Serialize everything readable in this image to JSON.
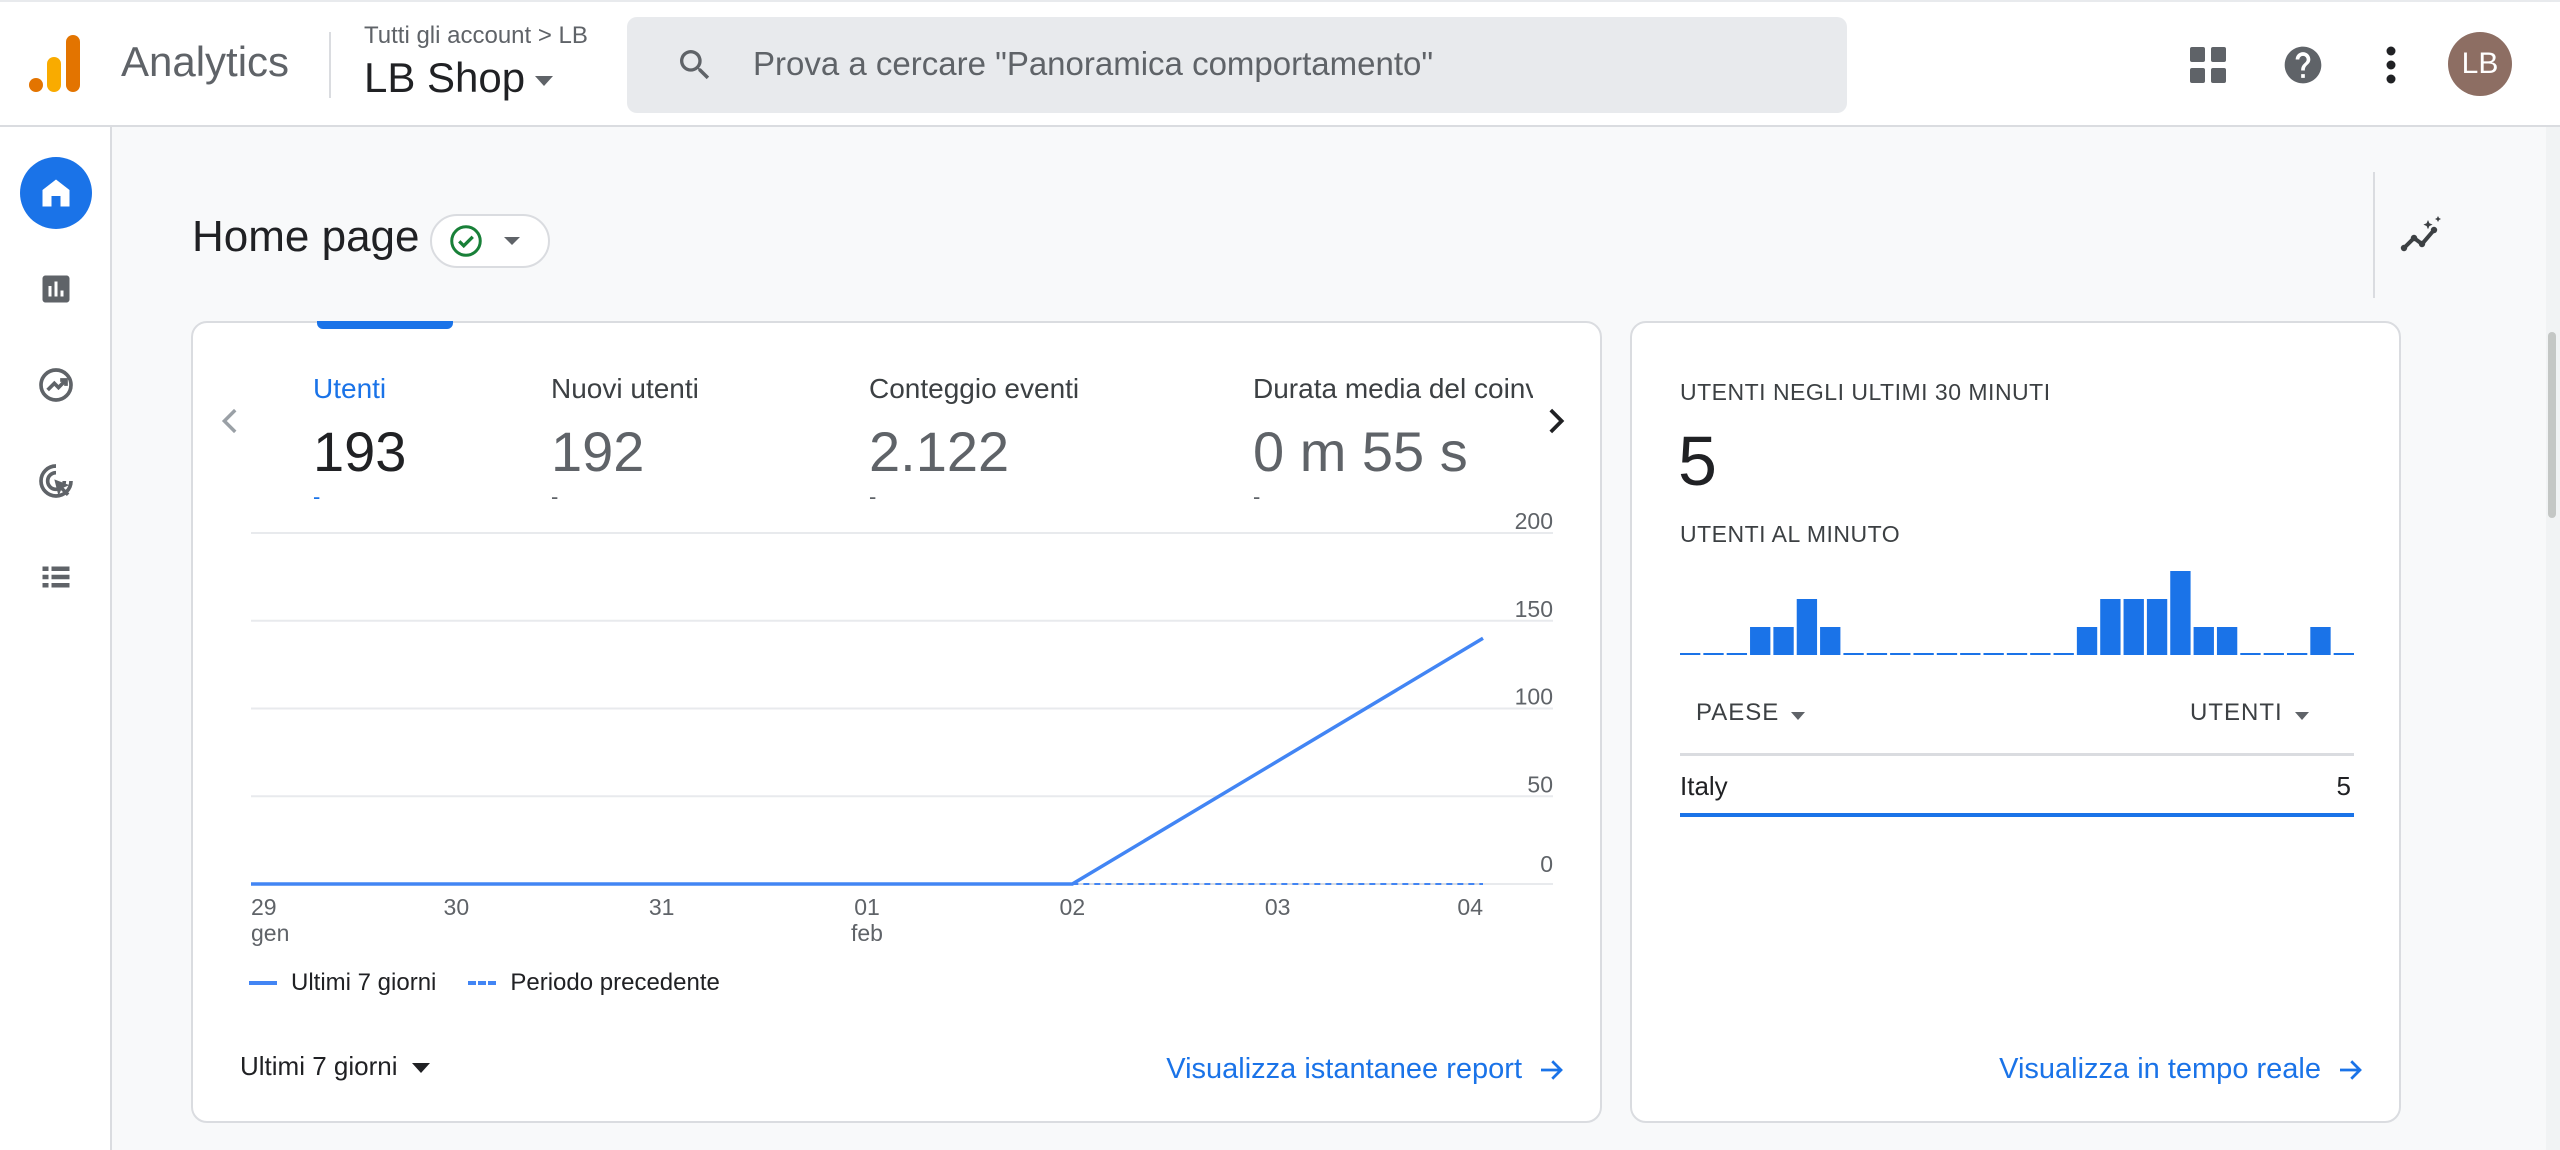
{
  "header": {
    "app_name": "Analytics",
    "breadcrumb": "Tutti gli account > LB",
    "property": "LB Shop",
    "search_placeholder": "Prova a cercare \"Panoramica comportamento\"",
    "avatar_initials": "LB",
    "icons": [
      "apps-grid-icon",
      "help-icon",
      "more-vert-icon"
    ]
  },
  "leftnav": {
    "items": [
      {
        "name": "home",
        "icon": "home-icon",
        "active": true
      },
      {
        "name": "reports",
        "icon": "bar-chart-icon",
        "active": false
      },
      {
        "name": "explore",
        "icon": "explore-icon",
        "active": false
      },
      {
        "name": "advertising",
        "icon": "advertising-icon",
        "active": false
      },
      {
        "name": "configure",
        "icon": "list-icon",
        "active": false
      }
    ]
  },
  "page": {
    "title": "Home page",
    "status": "check-circle-icon"
  },
  "overview": {
    "metrics": [
      {
        "label": "Utenti",
        "value": "193",
        "delta": "-",
        "active": true
      },
      {
        "label": "Nuovi utenti",
        "value": "192",
        "delta": "-",
        "active": false
      },
      {
        "label": "Conteggio eventi",
        "value": "2.122",
        "delta": "-",
        "active": false
      },
      {
        "label": "Durata media del coinvolgimento",
        "value": "0 m 55 s",
        "delta": "-",
        "active": false
      }
    ],
    "legend_current": "Ultimi 7 giorni",
    "legend_previous": "Periodo precedente",
    "date_range": "Ultimi 7 giorni",
    "link": "Visualizza istantanee report"
  },
  "chart_data": {
    "type": "line",
    "x": [
      "29 gen",
      "30",
      "31",
      "01 feb",
      "02",
      "03",
      "04"
    ],
    "x_tick_labels": [
      [
        "29",
        "gen"
      ],
      [
        "30"
      ],
      [
        "31"
      ],
      [
        "01",
        "feb"
      ],
      [
        "02"
      ],
      [
        "03"
      ],
      [
        "04"
      ]
    ],
    "y_ticks": [
      0,
      50,
      100,
      150,
      200
    ],
    "ylim": [
      0,
      200
    ],
    "grid": true,
    "legend_placement": "bottom-left",
    "series": [
      {
        "name": "Ultimi 7 giorni",
        "values": [
          0,
          0,
          0,
          0,
          0,
          70,
          140
        ],
        "style": "solid",
        "color": "#4285f4"
      },
      {
        "name": "Periodo precedente",
        "values": [
          null,
          null,
          null,
          null,
          0,
          0,
          0
        ],
        "style": "dashed",
        "color": "#4285f4"
      }
    ]
  },
  "realtime": {
    "title": "UTENTI NEGLI ULTIMI 30 MINUTI",
    "value": "5",
    "subtitle": "UTENTI AL MINUTO",
    "per_minute": [
      0,
      0,
      0,
      1,
      1,
      2,
      1,
      0,
      0,
      0,
      0,
      0,
      0,
      0,
      0,
      0,
      0,
      1,
      2,
      2,
      2,
      3,
      1,
      1,
      0,
      0,
      0,
      1,
      0
    ],
    "col_country": "PAESE",
    "col_users": "UTENTI",
    "rows": [
      {
        "country": "Italy",
        "users": "5"
      }
    ],
    "link": "Visualizza in tempo reale"
  },
  "colors": {
    "accent": "#1a73e8",
    "series": "#4285f4",
    "avatar": "#8d6e63"
  }
}
